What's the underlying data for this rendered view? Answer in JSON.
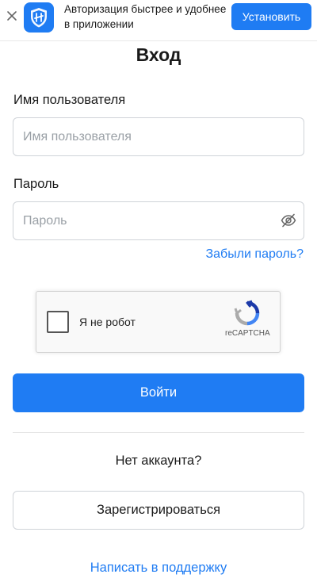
{
  "banner": {
    "text": "Авторизация быстрее и удобнее в приложении",
    "install_label": "Установить",
    "close_icon": "close-icon",
    "app_icon": "shield-app-icon",
    "accent_color": "#1f7cf3"
  },
  "login": {
    "title": "Вход",
    "username": {
      "label": "Имя пользователя",
      "placeholder": "Имя пользователя",
      "value": ""
    },
    "password": {
      "label": "Пароль",
      "placeholder": "Пароль",
      "value": "",
      "toggle_icon": "eye-off-icon"
    },
    "forgot_password": "Забыли пароль?",
    "captcha": {
      "label": "Я не робот",
      "brand": "reCAPTCHA",
      "checked": false
    },
    "submit_label": "Войти",
    "no_account_text": "Нет аккаунта?",
    "register_label": "Зарегистрироваться",
    "support_link": "Написать в поддержку"
  }
}
